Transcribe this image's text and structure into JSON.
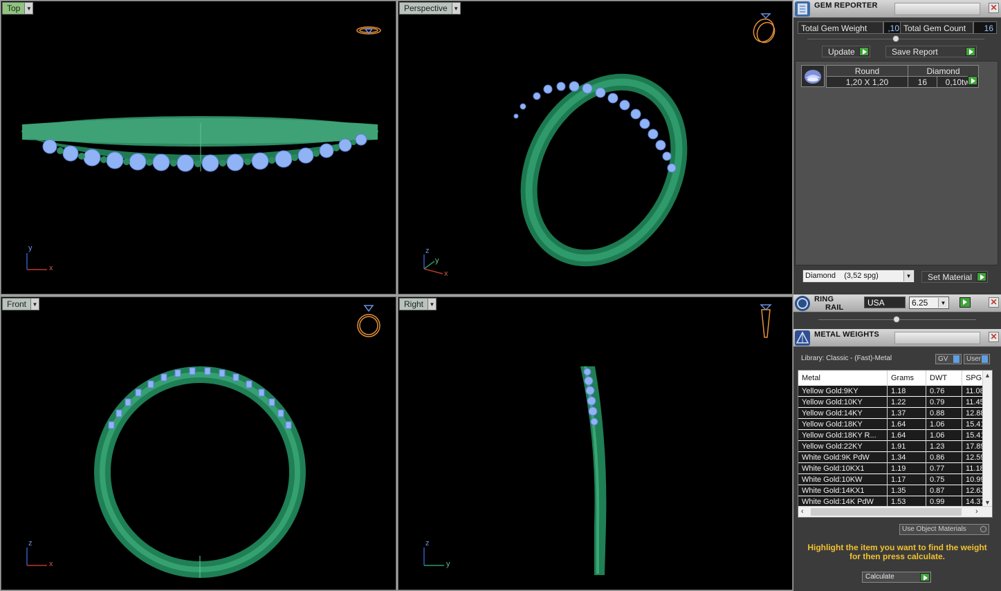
{
  "viewports": {
    "top": {
      "label": "Top",
      "axis_v": "y",
      "axis_h": "x"
    },
    "perspective": {
      "label": "Perspective",
      "axis_z": "z",
      "axis_y": "y",
      "axis_x": "x"
    },
    "front": {
      "label": "Front",
      "axis_v": "z",
      "axis_h": "x"
    },
    "right": {
      "label": "Right",
      "axis_v": "z",
      "axis_h": "y"
    }
  },
  "gem_reporter": {
    "title": "GEM REPORTER",
    "total_weight_label": "Total Gem Weight",
    "total_weight_value": ",10",
    "total_count_label": "Total Gem Count",
    "total_count_value": "16",
    "update_label": "Update",
    "save_report_label": "Save Report",
    "table": {
      "shape_header": "Round",
      "type_header": "Diamond",
      "size": "1,20 X 1,20",
      "count": "16",
      "weight": "0,10tw"
    },
    "material_select": "Diamond    (3,52 spg)",
    "set_material_label": "Set Material"
  },
  "ring_rail": {
    "title_line1": "RING",
    "title_line2": "RAIL",
    "region": "USA",
    "size": "6.25"
  },
  "metal_weights": {
    "title": "METAL WEIGHTS",
    "library": "Library: Classic - (Fast)-Metal",
    "gv_label": "GV",
    "user_label": "User",
    "columns": [
      "Metal",
      "Grams",
      "DWT",
      "SPG"
    ],
    "rows": [
      {
        "metal": "Yellow Gold:9KY",
        "grams": "1.18",
        "dwt": "0.76",
        "spg": "11.08"
      },
      {
        "metal": "Yellow Gold:10KY",
        "grams": "1.22",
        "dwt": "0.79",
        "spg": "11.45"
      },
      {
        "metal": "Yellow Gold:14KY",
        "grams": "1.37",
        "dwt": "0.88",
        "spg": "12.88"
      },
      {
        "metal": "Yellow Gold:18KY",
        "grams": "1.64",
        "dwt": "1.06",
        "spg": "15.41"
      },
      {
        "metal": "Yellow Gold:18KY R...",
        "grams": "1.64",
        "dwt": "1.06",
        "spg": "15.41"
      },
      {
        "metal": "Yellow Gold:22KY",
        "grams": "1.91",
        "dwt": "1.23",
        "spg": "17.89"
      },
      {
        "metal": "White Gold:9K PdW",
        "grams": "1.34",
        "dwt": "0.86",
        "spg": "12.59"
      },
      {
        "metal": "White Gold:10KX1",
        "grams": "1.19",
        "dwt": "0.77",
        "spg": "11.18"
      },
      {
        "metal": "White Gold:10KW",
        "grams": "1.17",
        "dwt": "0.75",
        "spg": "10.99"
      },
      {
        "metal": "White Gold:14KX1",
        "grams": "1.35",
        "dwt": "0.87",
        "spg": "12.63"
      },
      {
        "metal": "White Gold:14K PdW",
        "grams": "1.53",
        "dwt": "0.99",
        "spg": "14.37"
      }
    ],
    "use_object_materials_label": "Use Object Materials",
    "hint_line1": "Highlight the item you want to find the weight",
    "hint_line2": "for then press calculate.",
    "calculate_label": "Calculate"
  }
}
